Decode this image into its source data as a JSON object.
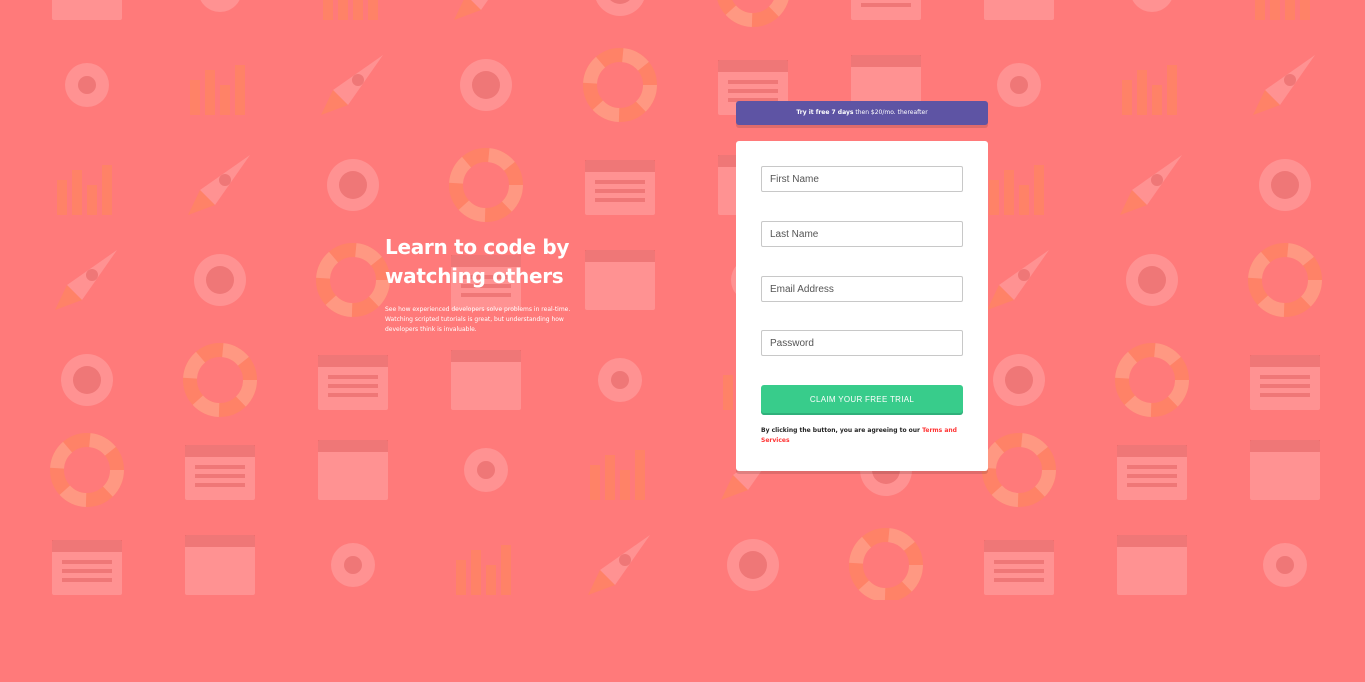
{
  "hero": {
    "title": "Learn to code by watching others",
    "description": "See how experienced developers solve problems in real-time. Watching scripted tutorials is great, but understanding how developers think is invaluable."
  },
  "banner": {
    "bold": "Try it free 7 days",
    "rest": " then $20/mo. thereafter"
  },
  "form": {
    "first_name_placeholder": "First Name",
    "last_name_placeholder": "Last Name",
    "email_placeholder": "Email Address",
    "password_placeholder": "Password",
    "submit_label": "CLAIM YOUR FREE TRIAL",
    "terms_text": "By clicking the button, you are agreeing to our ",
    "terms_link": "Terms and Services"
  },
  "colors": {
    "background": "#ff7a7a",
    "banner": "#5e54a4",
    "cta": "#38cc8b",
    "terms_link": "#ff3333"
  }
}
